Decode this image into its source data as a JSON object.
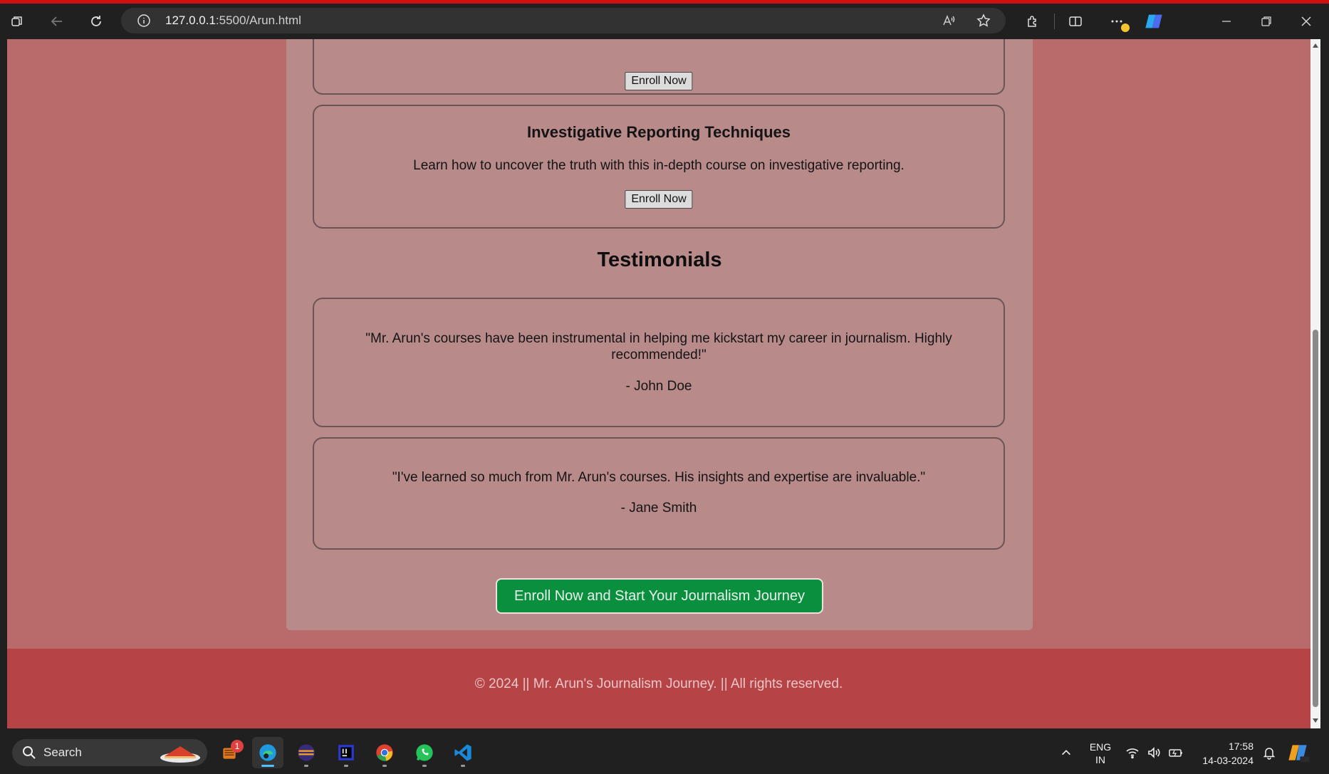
{
  "browser": {
    "url_host": "127.0.0.1",
    "url_rest": ":5500/Arun.html"
  },
  "page": {
    "courses": [
      {
        "title": "",
        "description": "",
        "button": "Enroll Now"
      },
      {
        "title": "Investigative Reporting Techniques",
        "description": "Learn how to uncover the truth with this in-depth course on investigative reporting.",
        "button": "Enroll Now"
      }
    ],
    "testimonials_heading": "Testimonials",
    "testimonials": [
      {
        "quote": "\"Mr. Arun's courses have been instrumental in helping me kickstart my career in journalism. Highly recommended!\"",
        "author": "- John Doe"
      },
      {
        "quote": "\"I've learned so much from Mr. Arun's courses. His insights and expertise are invaluable.\"",
        "author": "- Jane Smith"
      }
    ],
    "cta_button": "Enroll Now and Start Your Journalism Journey",
    "footer": "© 2024 || Mr. Arun's Journalism Journey. || All rights reserved."
  },
  "taskbar": {
    "search_label": "Search",
    "notification_count": "1",
    "language": "ENG",
    "region": "IN",
    "time": "17:58",
    "date": "14-03-2024"
  },
  "colors": {
    "page_bg": "#b96b6c",
    "container_bg": "#b98a8a",
    "footer_bg": "#b64446",
    "cta_bg": "#0a8f3e"
  },
  "icons": [
    "tab-actions-icon",
    "back-icon",
    "refresh-icon",
    "info-icon",
    "read-aloud-icon",
    "favorite-star-icon",
    "extensions-icon",
    "split-screen-icon",
    "more-icon",
    "copilot-icon",
    "minimize-icon",
    "restore-icon",
    "close-icon",
    "search-icon",
    "wifi-icon",
    "volume-icon",
    "battery-icon",
    "chevron-up-icon"
  ]
}
